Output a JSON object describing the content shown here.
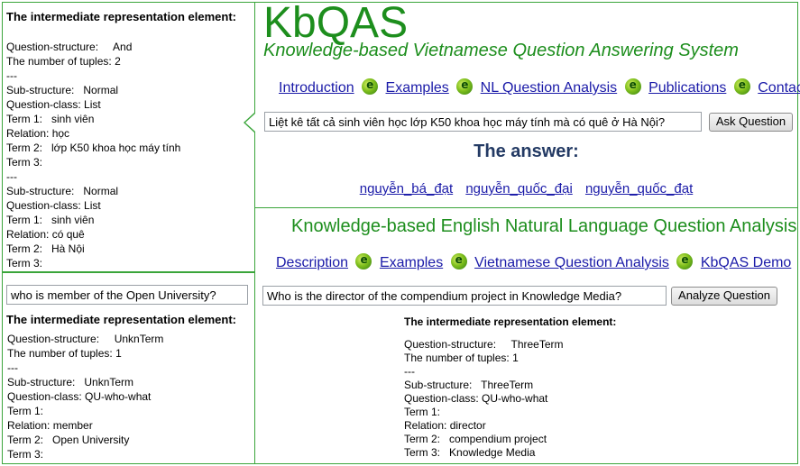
{
  "left_top": {
    "title": "The intermediate representation element:",
    "body": "Question-structure:     And\nThe number of tuples: 2\n---\nSub-structure:   Normal\nQuestion-class: List\nTerm 1:   sinh viên\nRelation: học\nTerm 2:   lớp K50 khoa học máy tính\nTerm 3:\n---\nSub-structure:   Normal\nQuestion-class: List\nTerm 1:   sinh viên\nRelation: có quê\nTerm 2:   Hà Nội\nTerm 3:"
  },
  "left_bottom": {
    "input_value": "who is member of the Open University?",
    "title": "The intermediate representation element:",
    "body": "Question-structure:     UnknTerm\nThe number of tuples: 1\n---\nSub-structure:   UnknTerm\nQuestion-class: QU-who-what\nTerm 1:\nRelation: member\nTerm 2:   Open University\nTerm 3:"
  },
  "kbqas": {
    "logo": "KbQAS",
    "subtitle": "Knowledge-based Vietnamese Question Answering System",
    "nav": [
      "Introduction",
      "Examples",
      "NL Question Analysis",
      "Publications",
      "Contact"
    ],
    "question_value": "Liệt kê tất cả sinh viên học lớp K50 khoa học máy tính mà có quê ở Hà Nội?",
    "ask_button": "Ask Question",
    "answer_heading": "The answer:",
    "answers": [
      "nguyễn_bá_đạt",
      "nguyễn_quốc_đại",
      "nguyễn_quốc_đạt"
    ]
  },
  "english": {
    "title": "Knowledge-based English Natural Language Question Analysis",
    "nav": [
      "Description",
      "Examples",
      "Vietnamese Question Analysis",
      "KbQAS Demo"
    ],
    "question_value": "Who is the director of the compendium project in Knowledge Media?",
    "analyze_button": "Analyze Question",
    "ir_title": "The intermediate representation element:",
    "ir_body": "Question-structure:     ThreeTerm\nThe number of tuples: 1\n---\nSub-structure:   ThreeTerm\nQuestion-class: QU-who-what\nTerm 1:\nRelation: director\nTerm 2:   compendium project\nTerm 3:   Knowledge Media"
  },
  "colors": {
    "accent_green": "#1d8e1d",
    "border_green": "#3aa53a",
    "link_blue": "#1a1aa8",
    "heading_navy": "#233a64"
  }
}
